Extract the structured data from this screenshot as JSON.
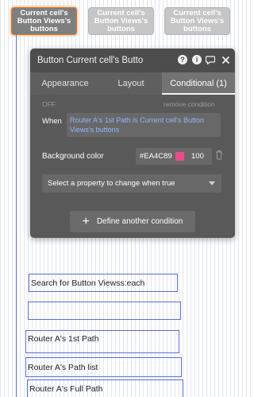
{
  "top_buttons": [
    {
      "label": "Current cell's Button Views's buttons"
    },
    {
      "label": "Current cell's Button Views's buttons"
    },
    {
      "label": "Current cell's Button Views's buttons"
    }
  ],
  "panel": {
    "title": "Button Current cell's Butto",
    "tabs": [
      "Appearance",
      "Layout",
      "Conditional (1)"
    ],
    "active_tab": "Conditional (1)",
    "off_label": "OFF",
    "remove_condition": "remove condition",
    "when_label": "When",
    "when_expression": "Router A's 1st Path is Current cell's Button Views's buttons",
    "background_label": "Background color",
    "color_hex": "#EA4C89",
    "opacity": "100",
    "select_placeholder": "Select a property to change when true",
    "define_label": "Define another condition",
    "colors": {
      "swatch": "#EA4C89",
      "panel": "#595959",
      "link_text": "#8fb6ff"
    }
  },
  "canvas_elements": {
    "search": "Search for Button Viewss:each",
    "path_1st": "Router A's 1st Path",
    "path_list": "Router A's Path list",
    "path_full": "Router A's Full Path"
  }
}
